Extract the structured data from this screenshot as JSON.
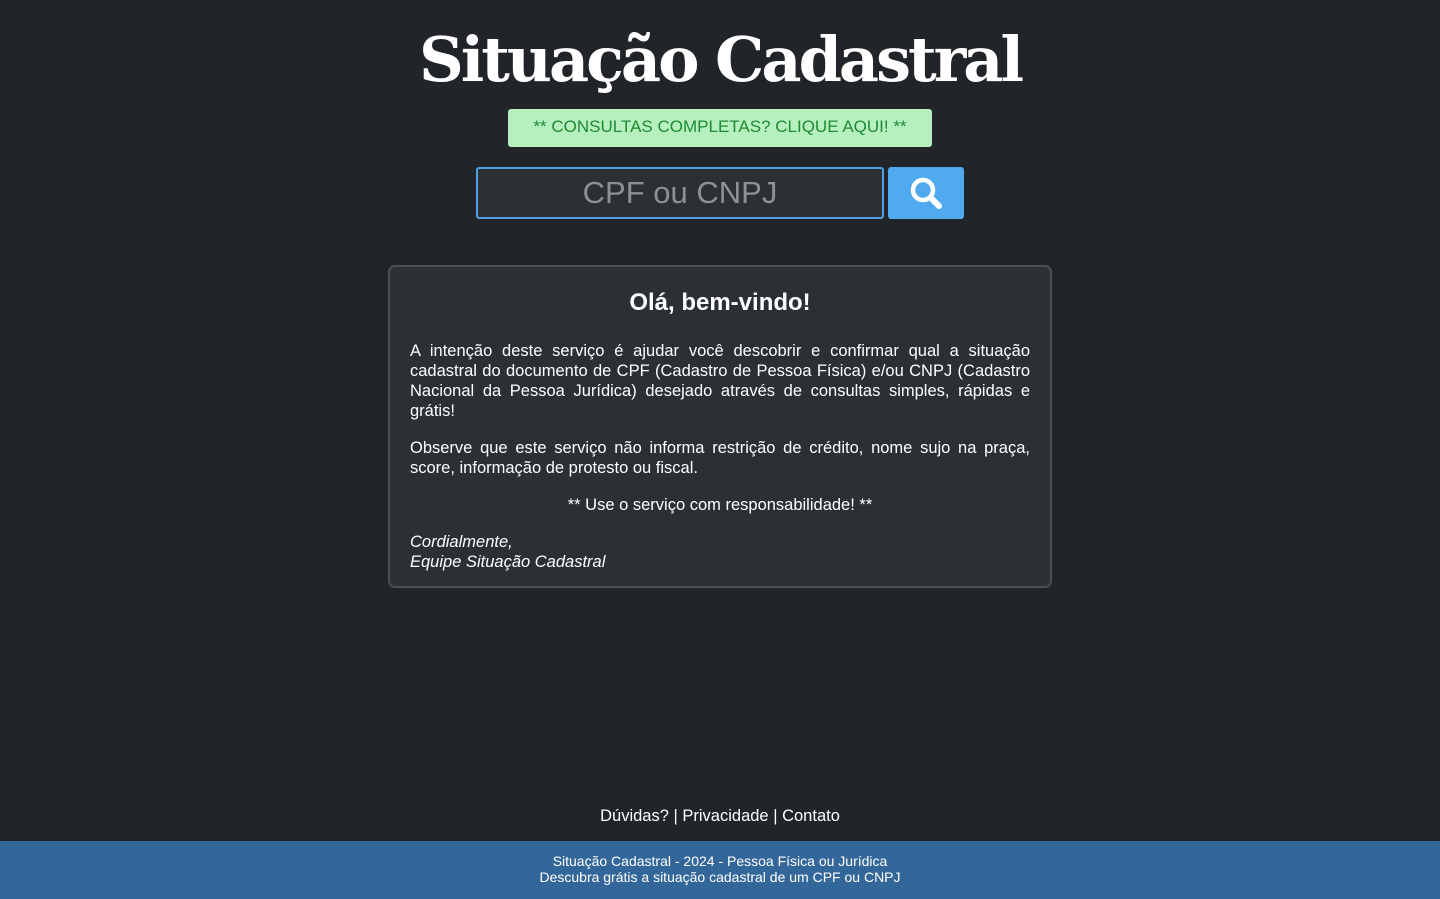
{
  "header": {
    "title": "Situação Cadastral"
  },
  "promo": {
    "label": "** CONSULTAS COMPLETAS? CLIQUE AQUI! **"
  },
  "search": {
    "placeholder": "CPF ou CNPJ",
    "value": "",
    "button_icon": "search-icon"
  },
  "welcome": {
    "title": "Olá, bem-vindo!",
    "paragraph_1": "A intenção deste serviço é ajudar você descobrir e confirmar qual a situação cadastral do documento de CPF (Cadastro de Pessoa Física) e/ou CNPJ (Cadastro Nacional da Pessoa Jurídica) desejado através de consultas simples, rápidas e grátis!",
    "paragraph_2": "Observe que este serviço não informa restrição de crédito, nome sujo na praça, score, informação de protesto ou fiscal.",
    "notice": "** Use o serviço com responsabilidade! **",
    "signoff_line_1": "Cordialmente,",
    "signoff_line_2": "Equipe Situação Cadastral"
  },
  "footer": {
    "links": [
      "Dúvidas?",
      "Privacidade",
      "Contato"
    ],
    "separator": "|",
    "line_1": "Situação Cadastral - 2024 - Pessoa Física ou Jurídica",
    "line_2": "Descubra grátis a situação cadastral de um CPF ou CNPJ"
  },
  "colors": {
    "background": "#212529",
    "card": "#2b3035",
    "accent_blue": "#4faaf0",
    "promo_bg": "#b7f0bf",
    "promo_text": "#1f8a34",
    "footer_bar": "#336699"
  }
}
